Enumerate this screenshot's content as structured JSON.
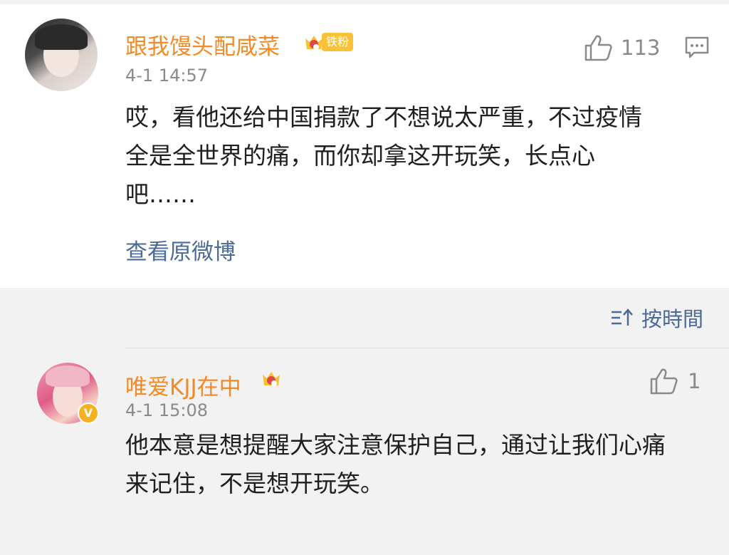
{
  "main_comment": {
    "username": "跟我馒头配咸菜",
    "badge_text": "铁粉",
    "time": "4-1 14:57",
    "like_count": "113",
    "content_lines": [
      "哎，看他还给中国捐款了不想说太严重，不过疫情",
      "全是全世界的痛，而你却拿这开玩笑，长点心",
      "吧……"
    ],
    "view_original": "查看原微博"
  },
  "sort": {
    "label": "按時間"
  },
  "reply": {
    "username": "唯爱KJJ在中",
    "verified_mark": "V",
    "time": "4-1 15:08",
    "like_count": "1",
    "content_lines": [
      "他本意是想提醒大家注意保护自己，通过让我们心痛",
      "来记住，不是想开玩笑。"
    ]
  },
  "colors": {
    "username": "#f28a25",
    "link": "#4c6a97",
    "badge": "#f8c238",
    "meta": "#8a8a8a"
  },
  "icons": [
    "thumbs-up-icon",
    "comment-icon",
    "sort-icon",
    "crown-badge-icon",
    "verified-icon"
  ]
}
